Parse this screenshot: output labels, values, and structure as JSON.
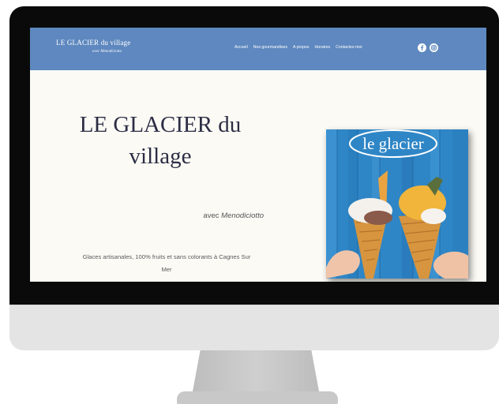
{
  "site": {
    "brand_title": "LE GLACIER du village",
    "brand_subtitle": "avec Menodiciotto",
    "nav": [
      "Accueil",
      "Nos gourmandises",
      "A propos",
      "Horaires",
      "Contactez-moi"
    ],
    "social": [
      "facebook-icon",
      "instagram-icon"
    ]
  },
  "hero": {
    "title_line1": "LE GLACIER du",
    "title_line2": "village",
    "subtitle_prefix": "avec ",
    "subtitle_author": "Menodiciotto",
    "description_line1": "Glaces artisanales, 100% fruits et sans colorants à Cagnes Sur",
    "description_line2": "Mer",
    "photo_sign": "le glacier"
  },
  "colors": {
    "header": "#5e88bf",
    "page_bg": "#fbfaf5",
    "title": "#2c2d44"
  }
}
